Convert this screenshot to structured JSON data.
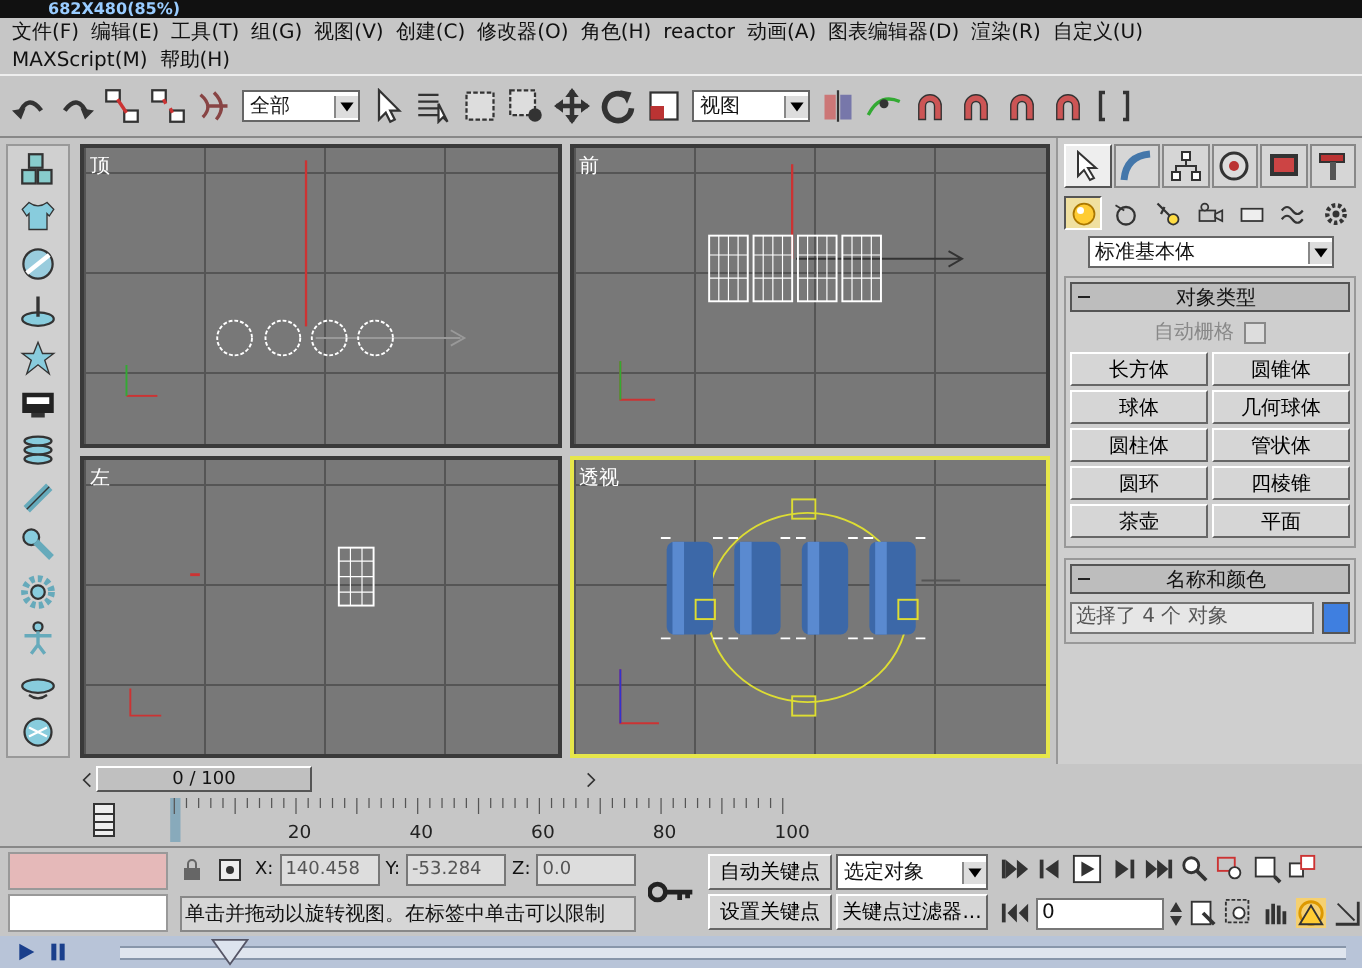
{
  "title": "682X480(85%)",
  "menu_rows": [
    [
      {
        "label": "文件(F)"
      },
      {
        "label": "编辑(E)"
      },
      {
        "label": "工具(T)"
      },
      {
        "label": "组(G)"
      },
      {
        "label": "视图(V)"
      },
      {
        "label": "创建(C)"
      },
      {
        "label": "修改器(O)"
      },
      {
        "label": "角色(H)"
      },
      {
        "label": "reactor"
      },
      {
        "label": "动画(A)"
      },
      {
        "label": "图表编辑器(D)"
      },
      {
        "label": "渲染(R)"
      },
      {
        "label": "自定义(U)"
      }
    ],
    [
      {
        "label": "MAXScript(M)"
      },
      {
        "label": "帮助(H)"
      }
    ]
  ],
  "toolbar": {
    "selection_filter": "全部",
    "reference_coord": "视图"
  },
  "viewports": [
    {
      "kind": "top",
      "label": "顶",
      "active": false
    },
    {
      "kind": "front",
      "label": "前",
      "active": false
    },
    {
      "kind": "left",
      "label": "左",
      "active": false
    },
    {
      "kind": "perspective",
      "label": "透视",
      "active": true
    }
  ],
  "command_panel": {
    "tabs": [
      {
        "selected": true
      },
      {
        "selected": false
      },
      {
        "selected": false
      },
      {
        "selected": false
      },
      {
        "selected": false
      },
      {
        "selected": false
      }
    ],
    "categories": [
      {
        "selected": true
      },
      {
        "selected": false
      },
      {
        "selected": false
      },
      {
        "selected": false
      },
      {
        "selected": false
      },
      {
        "selected": false
      },
      {
        "selected": false
      }
    ],
    "subtype": "标准基本体",
    "object_type": {
      "title": "对象类型",
      "autogrid": {
        "label": "自动栅格",
        "checked": false
      },
      "buttons": [
        "长方体",
        "圆锥体",
        "球体",
        "几何球体",
        "圆柱体",
        "管状体",
        "圆环",
        "四棱锥",
        "茶壶",
        "平面"
      ]
    },
    "name_color": {
      "title": "名称和颜色",
      "name": "选择了 4 个 对象",
      "color": "#3f7fe0"
    }
  },
  "time_slider": {
    "label": "0 / 100"
  },
  "ruler_ticks": [
    "20",
    "40",
    "60",
    "80",
    "100"
  ],
  "coordinates": [
    {
      "axis": "X:",
      "value": "140.458"
    },
    {
      "axis": "Y:",
      "value": "-53.284"
    },
    {
      "axis": "Z:",
      "value": "0.0"
    }
  ],
  "keys": {
    "auto_key": "自动关键点",
    "key_mode": "选定对象",
    "set_key": "设置关键点",
    "key_filters": "关键点过滤器..."
  },
  "prompt": "单击并拖动以旋转视图。在标签中单击可以限制",
  "frame": "0",
  "player": {
    "level": 0.09
  }
}
